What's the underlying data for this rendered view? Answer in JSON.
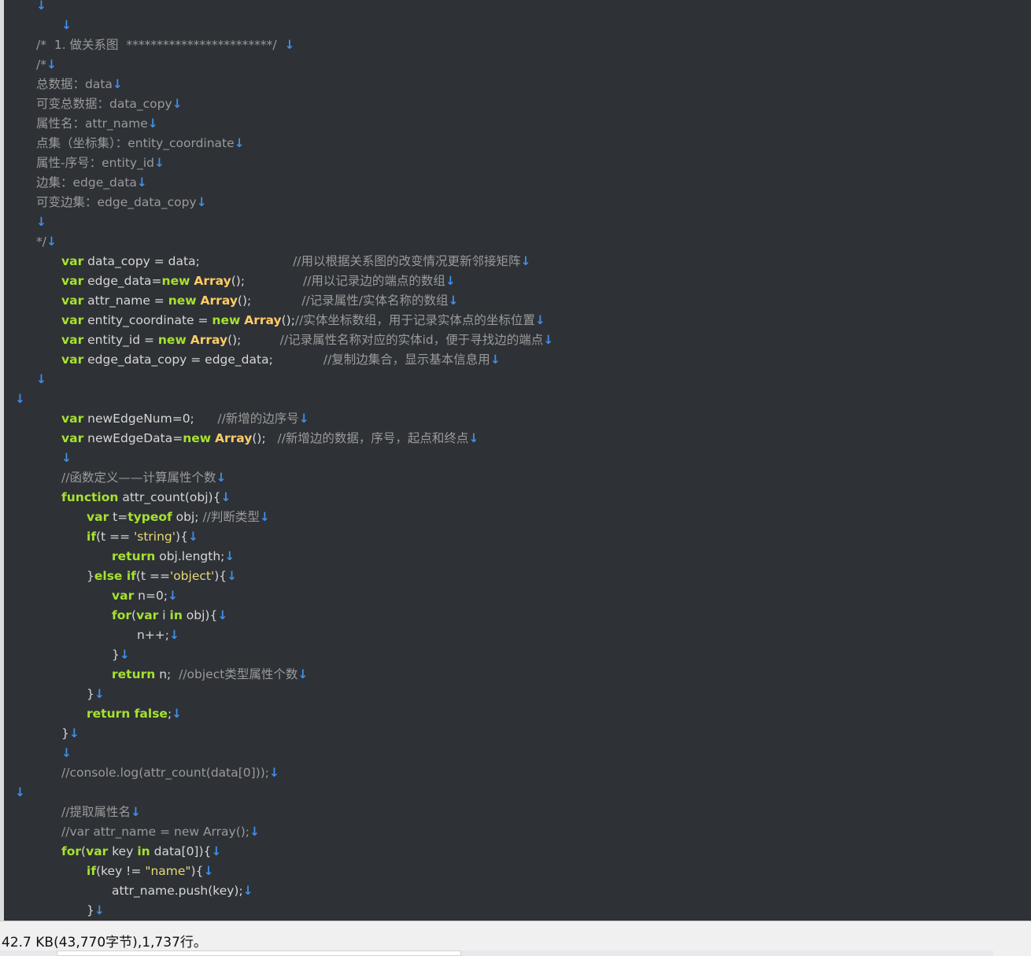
{
  "colors": {
    "editor_bg": "#2e3136",
    "keyword": "#a6e22e",
    "class": "#ffcc66",
    "string": "#e6db74",
    "comment": "#9a9a9a",
    "newline_marker": "#3f8fe6",
    "text": "#d6d6d6"
  },
  "editor": {
    "lines": [
      {
        "indent": 1,
        "tokens": [
          [
            "nl",
            "↓"
          ]
        ]
      },
      {
        "indent": 2,
        "tokens": [
          [
            "nl",
            "↓"
          ]
        ]
      },
      {
        "indent": 1,
        "tokens": [
          [
            "cm",
            "/*  1. 做关系图  ************************/  "
          ],
          [
            "nl",
            "↓"
          ]
        ]
      },
      {
        "indent": 1,
        "tokens": [
          [
            "cm",
            "/*"
          ],
          [
            "nl",
            "↓"
          ]
        ]
      },
      {
        "indent": 1,
        "tokens": [
          [
            "cm",
            "总数据：data"
          ],
          [
            "nl",
            "↓"
          ]
        ]
      },
      {
        "indent": 1,
        "tokens": [
          [
            "cm",
            "可变总数据：data_copy"
          ],
          [
            "nl",
            "↓"
          ]
        ]
      },
      {
        "indent": 1,
        "tokens": [
          [
            "cm",
            "属性名：attr_name"
          ],
          [
            "nl",
            "↓"
          ]
        ]
      },
      {
        "indent": 1,
        "tokens": [
          [
            "cm",
            "点集（坐标集）：entity_coordinate"
          ],
          [
            "nl",
            "↓"
          ]
        ]
      },
      {
        "indent": 1,
        "tokens": [
          [
            "cm",
            "属性-序号：entity_id"
          ],
          [
            "nl",
            "↓"
          ]
        ]
      },
      {
        "indent": 1,
        "tokens": [
          [
            "cm",
            "边集：edge_data"
          ],
          [
            "nl",
            "↓"
          ]
        ]
      },
      {
        "indent": 1,
        "tokens": [
          [
            "cm",
            "可变边集：edge_data_copy"
          ],
          [
            "nl",
            "↓"
          ]
        ]
      },
      {
        "indent": 1,
        "tokens": [
          [
            "nl",
            "↓"
          ]
        ]
      },
      {
        "indent": 1,
        "tokens": [
          [
            "cm",
            "*/"
          ],
          [
            "nl",
            "↓"
          ]
        ]
      },
      {
        "indent": 2,
        "tokens": [
          [
            "kw",
            "var"
          ],
          [
            "plain",
            " data_copy = data;                        "
          ],
          [
            "cm",
            "//用以根据关系图的改变情况更新邻接矩阵"
          ],
          [
            "nl",
            "↓"
          ]
        ]
      },
      {
        "indent": 2,
        "tokens": [
          [
            "kw",
            "var"
          ],
          [
            "plain",
            " edge_data="
          ],
          [
            "kw",
            "new"
          ],
          [
            "plain",
            " "
          ],
          [
            "cls",
            "Array"
          ],
          [
            "plain",
            "();               "
          ],
          [
            "cm",
            "//用以记录边的端点的数组"
          ],
          [
            "nl",
            "↓"
          ]
        ]
      },
      {
        "indent": 2,
        "tokens": [
          [
            "kw",
            "var"
          ],
          [
            "plain",
            " attr_name = "
          ],
          [
            "kw",
            "new"
          ],
          [
            "plain",
            " "
          ],
          [
            "cls",
            "Array"
          ],
          [
            "plain",
            "();             "
          ],
          [
            "cm",
            "//记录属性/实体名称的数组"
          ],
          [
            "nl",
            "↓"
          ]
        ]
      },
      {
        "indent": 2,
        "tokens": [
          [
            "kw",
            "var"
          ],
          [
            "plain",
            " entity_coordinate = "
          ],
          [
            "kw",
            "new"
          ],
          [
            "plain",
            " "
          ],
          [
            "cls",
            "Array"
          ],
          [
            "plain",
            "();"
          ],
          [
            "cm",
            "//实体坐标数组，用于记录实体点的坐标位置"
          ],
          [
            "nl",
            "↓"
          ]
        ]
      },
      {
        "indent": 2,
        "tokens": [
          [
            "kw",
            "var"
          ],
          [
            "plain",
            " entity_id = "
          ],
          [
            "kw",
            "new"
          ],
          [
            "plain",
            " "
          ],
          [
            "cls",
            "Array"
          ],
          [
            "plain",
            "();          "
          ],
          [
            "cm",
            "//记录属性名称对应的实体id，便于寻找边的端点"
          ],
          [
            "nl",
            "↓"
          ]
        ]
      },
      {
        "indent": 2,
        "tokens": [
          [
            "kw",
            "var"
          ],
          [
            "plain",
            " edge_data_copy = edge_data;             "
          ],
          [
            "cm",
            "//复制边集合，显示基本信息用"
          ],
          [
            "nl",
            "↓"
          ]
        ]
      },
      {
        "indent": 1,
        "tokens": [
          [
            "nl",
            "↓"
          ]
        ]
      },
      {
        "indent": 0,
        "tokens": [
          [
            "nl",
            "↓"
          ]
        ]
      },
      {
        "indent": 2,
        "tokens": [
          [
            "kw",
            "var"
          ],
          [
            "plain",
            " newEdgeNum=0;      "
          ],
          [
            "cm",
            "//新增的边序号"
          ],
          [
            "nl",
            "↓"
          ]
        ]
      },
      {
        "indent": 2,
        "tokens": [
          [
            "kw",
            "var"
          ],
          [
            "plain",
            " newEdgeData="
          ],
          [
            "kw",
            "new"
          ],
          [
            "plain",
            " "
          ],
          [
            "cls",
            "Array"
          ],
          [
            "plain",
            "();   "
          ],
          [
            "cm",
            "//新增边的数据，序号，起点和终点"
          ],
          [
            "nl",
            "↓"
          ]
        ]
      },
      {
        "indent": 2,
        "tokens": [
          [
            "nl",
            "↓"
          ]
        ]
      },
      {
        "indent": 2,
        "tokens": [
          [
            "cm",
            "//函数定义——计算属性个数"
          ],
          [
            "nl",
            "↓"
          ]
        ]
      },
      {
        "indent": 2,
        "tokens": [
          [
            "kw",
            "function"
          ],
          [
            "plain",
            " attr_count(obj){"
          ],
          [
            "nl",
            "↓"
          ]
        ]
      },
      {
        "indent": 3,
        "tokens": [
          [
            "kw",
            "var"
          ],
          [
            "plain",
            " t="
          ],
          [
            "kw",
            "typeof"
          ],
          [
            "plain",
            " obj; "
          ],
          [
            "cm",
            "//判断类型"
          ],
          [
            "nl",
            "↓"
          ]
        ]
      },
      {
        "indent": 3,
        "tokens": [
          [
            "kw",
            "if"
          ],
          [
            "plain",
            "(t == "
          ],
          [
            "str",
            "'string'"
          ],
          [
            "plain",
            "){"
          ],
          [
            "nl",
            "↓"
          ]
        ]
      },
      {
        "indent": 4,
        "tokens": [
          [
            "kw",
            "return"
          ],
          [
            "plain",
            " obj.length;"
          ],
          [
            "nl",
            "↓"
          ]
        ]
      },
      {
        "indent": 3,
        "tokens": [
          [
            "plain",
            "}"
          ],
          [
            "kw",
            "else if"
          ],
          [
            "plain",
            "(t =="
          ],
          [
            "str",
            "'object'"
          ],
          [
            "plain",
            "){"
          ],
          [
            "nl",
            "↓"
          ]
        ]
      },
      {
        "indent": 4,
        "tokens": [
          [
            "kw",
            "var"
          ],
          [
            "plain",
            " n=0;"
          ],
          [
            "nl",
            "↓"
          ]
        ]
      },
      {
        "indent": 4,
        "tokens": [
          [
            "kw",
            "for"
          ],
          [
            "plain",
            "("
          ],
          [
            "kw",
            "var"
          ],
          [
            "plain",
            " i "
          ],
          [
            "kw",
            "in"
          ],
          [
            "plain",
            " obj){"
          ],
          [
            "nl",
            "↓"
          ]
        ]
      },
      {
        "indent": 5,
        "tokens": [
          [
            "plain",
            "n++;"
          ],
          [
            "nl",
            "↓"
          ]
        ]
      },
      {
        "indent": 4,
        "tokens": [
          [
            "plain",
            "}"
          ],
          [
            "nl",
            "↓"
          ]
        ]
      },
      {
        "indent": 4,
        "tokens": [
          [
            "kw",
            "return"
          ],
          [
            "plain",
            " n;  "
          ],
          [
            "cm",
            "//object类型属性个数"
          ],
          [
            "nl",
            "↓"
          ]
        ]
      },
      {
        "indent": 3,
        "tokens": [
          [
            "plain",
            "}"
          ],
          [
            "nl",
            "↓"
          ]
        ]
      },
      {
        "indent": 3,
        "tokens": [
          [
            "kw",
            "return false"
          ],
          [
            "plain",
            ";"
          ],
          [
            "nl",
            "↓"
          ]
        ]
      },
      {
        "indent": 2,
        "tokens": [
          [
            "plain",
            "}"
          ],
          [
            "nl",
            "↓"
          ]
        ]
      },
      {
        "indent": 2,
        "tokens": [
          [
            "nl",
            "↓"
          ]
        ]
      },
      {
        "indent": 2,
        "tokens": [
          [
            "cm",
            "//console.log(attr_count(data[0]));"
          ],
          [
            "nl",
            "↓"
          ]
        ]
      },
      {
        "indent": 0,
        "tokens": [
          [
            "nl",
            "↓"
          ]
        ]
      },
      {
        "indent": 2,
        "tokens": [
          [
            "cm",
            "//提取属性名"
          ],
          [
            "nl",
            "↓"
          ]
        ]
      },
      {
        "indent": 2,
        "tokens": [
          [
            "cm",
            "//var attr_name = new Array();"
          ],
          [
            "nl",
            "↓"
          ]
        ]
      },
      {
        "indent": 2,
        "tokens": [
          [
            "kw",
            "for"
          ],
          [
            "plain",
            "("
          ],
          [
            "kw",
            "var"
          ],
          [
            "plain",
            " key "
          ],
          [
            "kw",
            "in"
          ],
          [
            "plain",
            " data[0]){"
          ],
          [
            "nl",
            "↓"
          ]
        ]
      },
      {
        "indent": 3,
        "tokens": [
          [
            "kw",
            "if"
          ],
          [
            "plain",
            "(key != "
          ],
          [
            "str",
            "\"name\""
          ],
          [
            "plain",
            "){"
          ],
          [
            "nl",
            "↓"
          ]
        ]
      },
      {
        "indent": 4,
        "tokens": [
          [
            "plain",
            "attr_name.push(key);"
          ],
          [
            "nl",
            "↓"
          ]
        ]
      },
      {
        "indent": 3,
        "tokens": [
          [
            "plain",
            "}"
          ],
          [
            "nl",
            "↓"
          ]
        ]
      }
    ]
  },
  "statusbar": {
    "text": "42.7 KB(43,770字节),1,737行。"
  }
}
